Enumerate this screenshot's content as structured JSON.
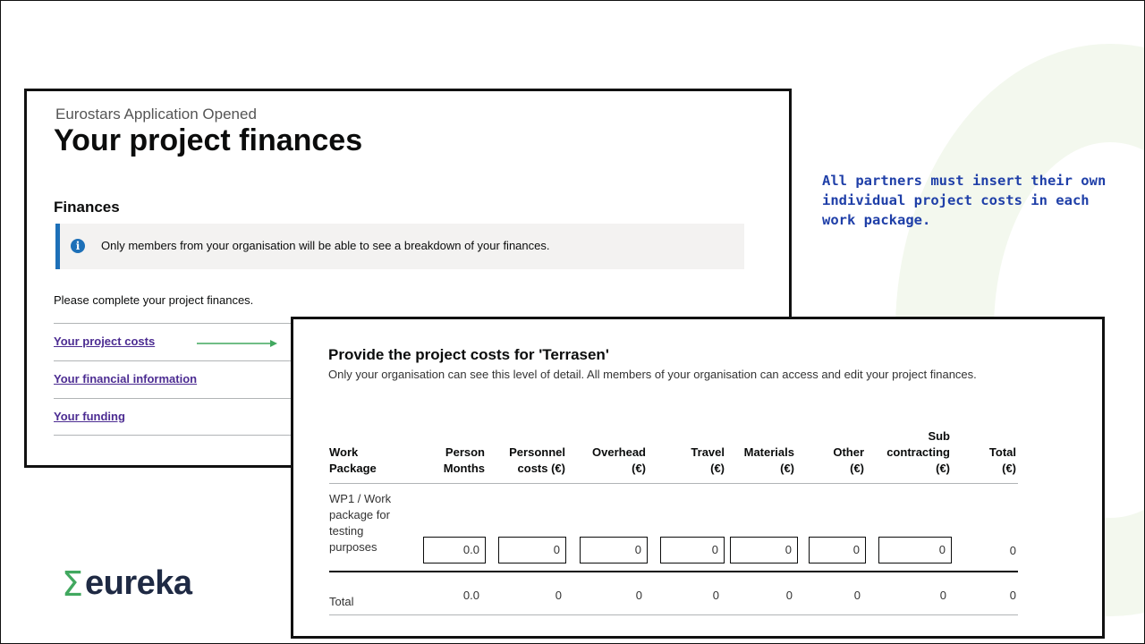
{
  "finances_page": {
    "subtitle": "Eurostars Application Opened",
    "title": "Your project finances",
    "section_heading": "Finances",
    "notice": "Only members from your organisation will be able to see a breakdown of your finances.",
    "prompt": "Please complete your project finances.",
    "links": [
      "Your project costs",
      "Your financial information",
      "Your funding"
    ]
  },
  "annotation": "All partners must insert their own individual project costs in each work package.",
  "logo": {
    "symbol": "Σ",
    "text": "eureka"
  },
  "costs_page": {
    "title": "Provide the project costs for 'Terrasen'",
    "description": "Only your organisation can see this level of detail. All members of your organisation can access and edit your project finances.",
    "columns": [
      {
        "line1": "Work",
        "line2": "Package"
      },
      {
        "line1": "Person",
        "line2": "Months"
      },
      {
        "line1": "Personnel",
        "line2": "costs (€)"
      },
      {
        "line1": "Overhead",
        "line2": "(€)"
      },
      {
        "line1": "Travel",
        "line2": "(€)"
      },
      {
        "line1": "Materials",
        "line2": "(€)"
      },
      {
        "line1": "Other",
        "line2": "(€)"
      },
      {
        "line0": "Sub",
        "line1": "contracting",
        "line2": "(€)"
      },
      {
        "line1": "Total",
        "line2": "(€)"
      }
    ],
    "row": {
      "label": "WP1 / Work package for testing purposes",
      "inputs": [
        "0.0",
        "0",
        "0",
        "0",
        "0",
        "0",
        "0"
      ],
      "total": "0"
    },
    "totals": {
      "label": "Total",
      "values": [
        "0.0",
        "0",
        "0",
        "0",
        "0",
        "0",
        "0",
        "0"
      ]
    }
  },
  "colors": {
    "link": "#4c2c92",
    "notice_border": "#1d70b8",
    "annotation": "#1f3fa8",
    "arrow": "#41a85f",
    "logo_sigma": "#41a85f"
  }
}
